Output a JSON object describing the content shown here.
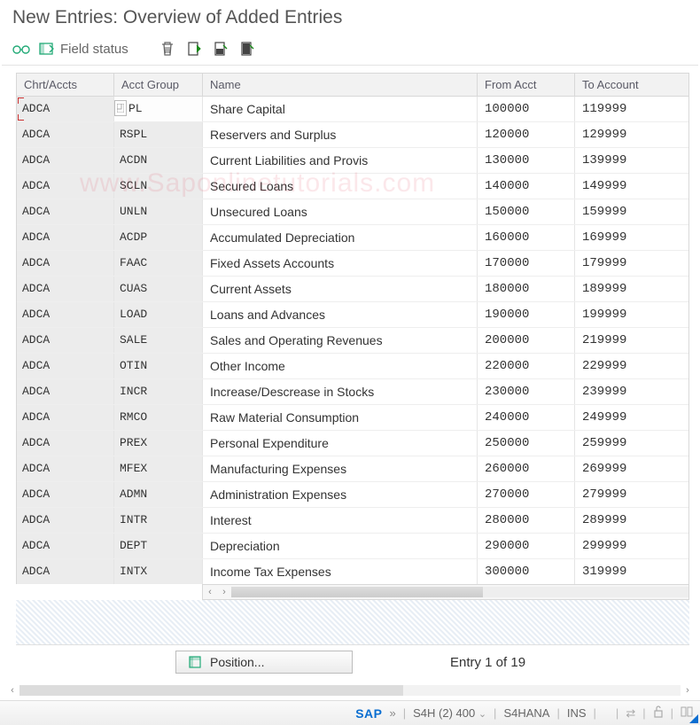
{
  "header": {
    "title": "New Entries: Overview of Added Entries"
  },
  "toolbar": {
    "field_status": "Field status"
  },
  "columns": {
    "chart": "Chrt/Accts",
    "group": "Acct Group",
    "name": "Name",
    "from": "From Acct",
    "to": "To Account"
  },
  "rows": [
    {
      "chart": "ADCA",
      "group": "PL",
      "name": "Share Capital",
      "from": "100000",
      "to": "119999"
    },
    {
      "chart": "ADCA",
      "group": "RSPL",
      "name": "Reservers and Surplus",
      "from": "120000",
      "to": "129999"
    },
    {
      "chart": "ADCA",
      "group": "ACDN",
      "name": "Current Liabilities and Provis",
      "from": "130000",
      "to": "139999"
    },
    {
      "chart": "ADCA",
      "group": "SCLN",
      "name": "Secured Loans",
      "from": "140000",
      "to": "149999"
    },
    {
      "chart": "ADCA",
      "group": "UNLN",
      "name": "Unsecured Loans",
      "from": "150000",
      "to": "159999"
    },
    {
      "chart": "ADCA",
      "group": "ACDP",
      "name": "Accumulated Depreciation",
      "from": "160000",
      "to": "169999"
    },
    {
      "chart": "ADCA",
      "group": "FAAC",
      "name": "Fixed Assets Accounts",
      "from": "170000",
      "to": "179999"
    },
    {
      "chart": "ADCA",
      "group": "CUAS",
      "name": "Current Assets",
      "from": "180000",
      "to": "189999"
    },
    {
      "chart": "ADCA",
      "group": "LOAD",
      "name": "Loans and Advances",
      "from": "190000",
      "to": "199999"
    },
    {
      "chart": "ADCA",
      "group": "SALE",
      "name": "Sales and Operating Revenues",
      "from": "200000",
      "to": "219999"
    },
    {
      "chart": "ADCA",
      "group": "OTIN",
      "name": "Other Income",
      "from": "220000",
      "to": "229999"
    },
    {
      "chart": "ADCA",
      "group": "INCR",
      "name": "Increase/Descrease in Stocks",
      "from": "230000",
      "to": "239999"
    },
    {
      "chart": "ADCA",
      "group": "RMCO",
      "name": "Raw Material Consumption",
      "from": "240000",
      "to": "249999"
    },
    {
      "chart": "ADCA",
      "group": "PREX",
      "name": "Personal Expenditure",
      "from": "250000",
      "to": "259999"
    },
    {
      "chart": "ADCA",
      "group": "MFEX",
      "name": "Manufacturing Expenses",
      "from": "260000",
      "to": "269999"
    },
    {
      "chart": "ADCA",
      "group": "ADMN",
      "name": "Administration Expenses",
      "from": "270000",
      "to": "279999"
    },
    {
      "chart": "ADCA",
      "group": "INTR",
      "name": "Interest",
      "from": "280000",
      "to": "289999"
    },
    {
      "chart": "ADCA",
      "group": "DEPT",
      "name": "Depreciation",
      "from": "290000",
      "to": "299999"
    },
    {
      "chart": "ADCA",
      "group": "INTX",
      "name": "Income Tax Expenses",
      "from": "300000",
      "to": "319999"
    }
  ],
  "footer": {
    "position_label": "Position...",
    "entry_status": "Entry 1 of 19"
  },
  "statusbar": {
    "sap": "SAP",
    "chev": "»",
    "system": "S4H (2) 400",
    "server": "S4HANA",
    "mode": "INS"
  },
  "watermark": "www.Saponlinetutorials.com"
}
